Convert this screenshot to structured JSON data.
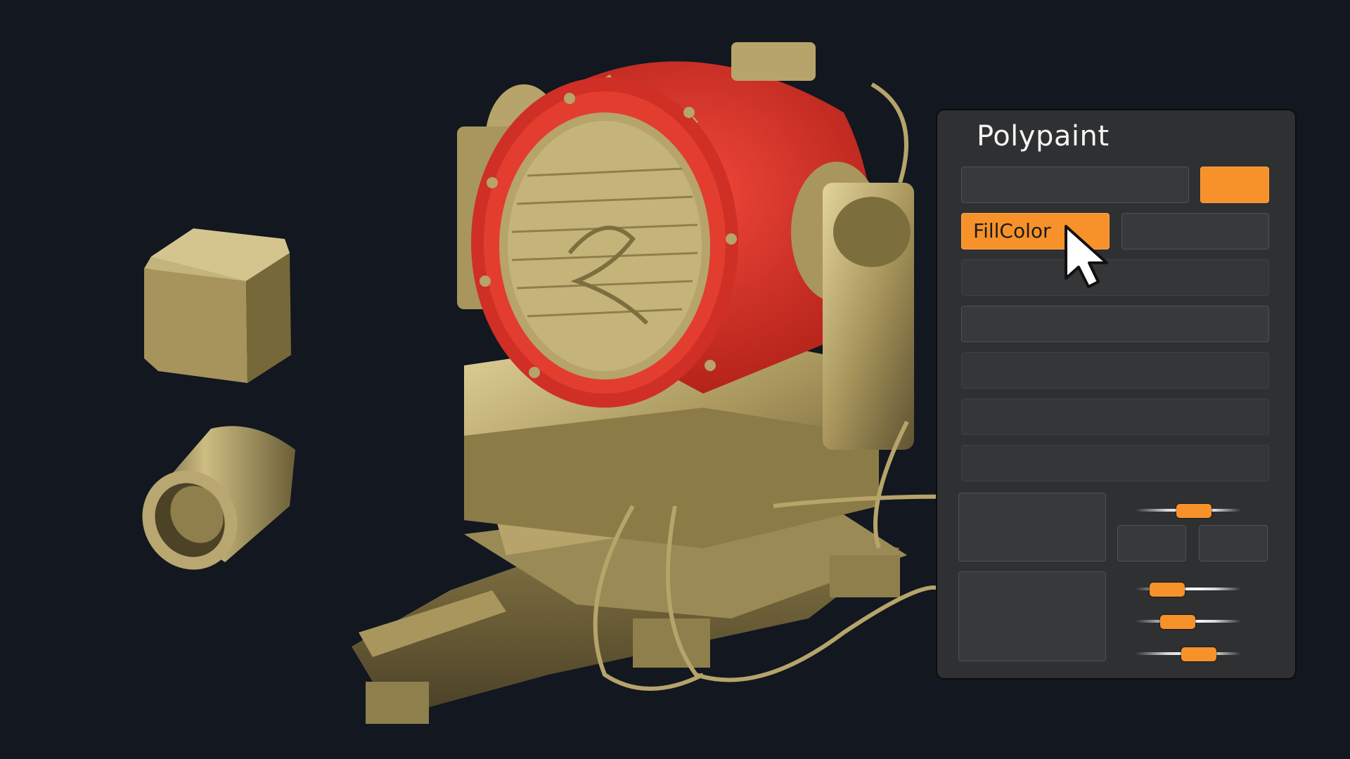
{
  "panel": {
    "title": "Polypaint",
    "fill_button_label": "FillColor",
    "swatch_color": "#f7912a",
    "accent_color": "#f7912a"
  },
  "sliders": [
    {
      "name": "slider-1",
      "value": 0.55
    },
    {
      "name": "slider-2",
      "value": 0.3
    },
    {
      "name": "slider-3",
      "value": 0.4
    },
    {
      "name": "slider-4",
      "value": 0.6
    }
  ],
  "icons": {
    "cursor": "arrow-cursor-icon",
    "cube": "cube-primitive-icon",
    "cylinder": "cylinder-primitive-icon"
  },
  "scene": {
    "model_color": "#b6a46a",
    "mask_color": "#e03a2c",
    "background": "#121720"
  }
}
